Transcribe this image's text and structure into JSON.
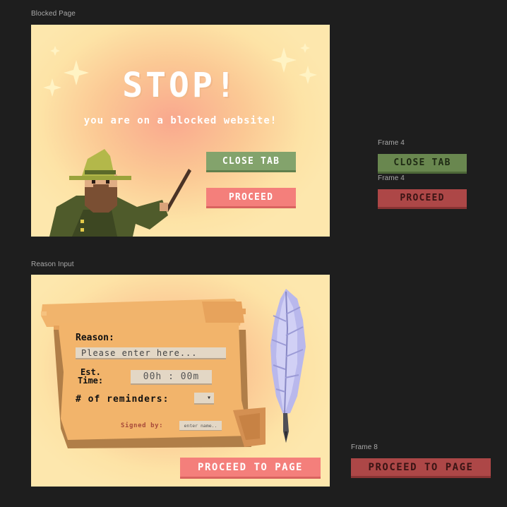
{
  "frames": {
    "blocked_label": "Blocked Page",
    "reason_label": "Reason Input",
    "frame4_label_a": "Frame 4",
    "frame4_label_b": "Frame 4",
    "frame8_label": "Frame 8"
  },
  "blocked": {
    "title": "STOP!",
    "subtitle": "you are on a blocked website!",
    "close_tab": "CLOSE TAB",
    "proceed": "PROCEED"
  },
  "reason": {
    "reason_label": "Reason:",
    "reason_placeholder": "Please enter here...",
    "est_time_label_1": "Est.",
    "est_time_label_2": "Time:",
    "time_value": "00h : 00m",
    "reminders_label": "# of reminders:",
    "reminders_caret": "▾",
    "signed_by": "Signed by:",
    "name_placeholder": "enter name..",
    "proceed_to_page": "PROCEED TO PAGE"
  },
  "external": {
    "close_tab": "CLOSE TAB",
    "proceed": "PROCEED",
    "proceed_to_page": "PROCEED TO PAGE"
  },
  "colors": {
    "canvas": "#1e1e1e",
    "green": "#83a36c",
    "pink": "#f47f7b",
    "dark_green": "#69874f",
    "dark_red": "#ad4747"
  },
  "icons": [
    "sparkle-icon",
    "wizard-illustration",
    "scroll-illustration",
    "quill-icon"
  ]
}
